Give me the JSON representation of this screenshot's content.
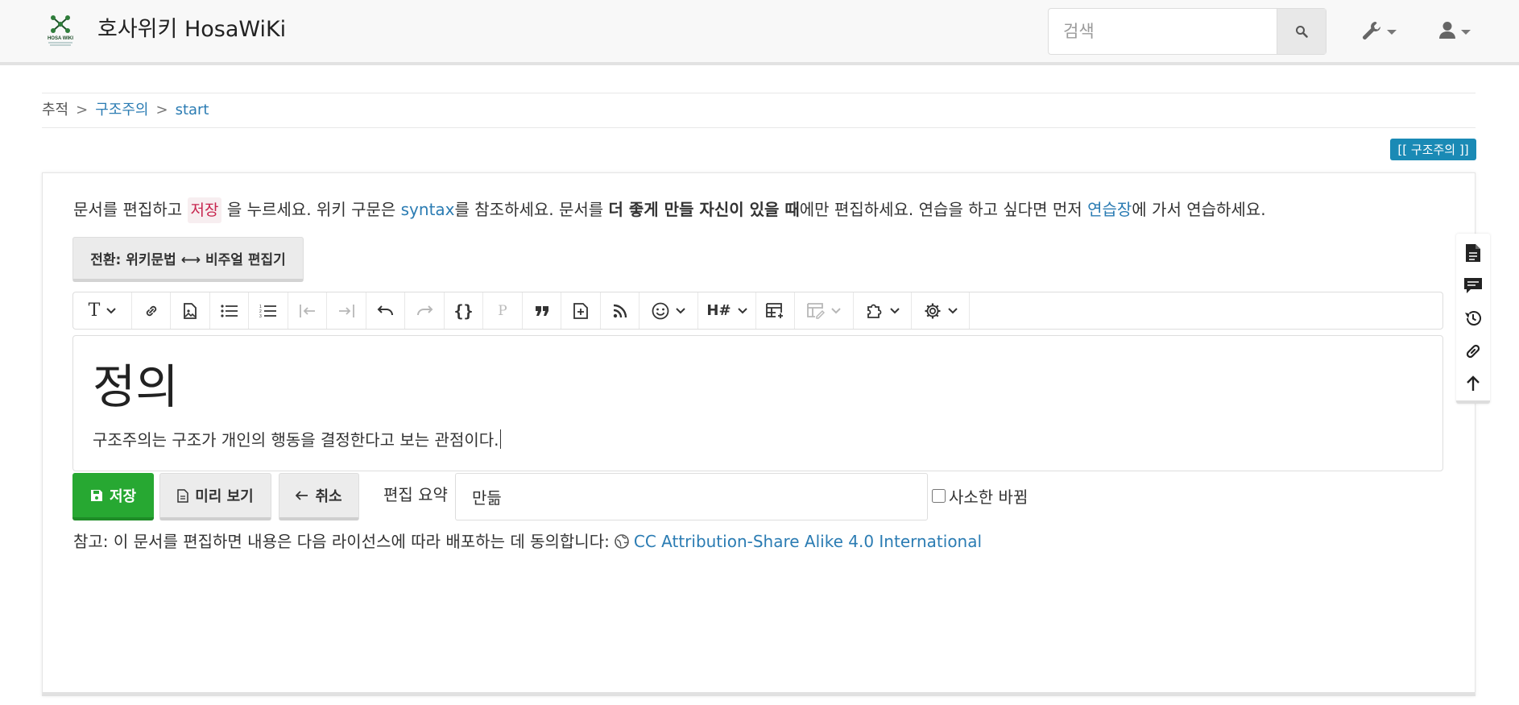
{
  "header": {
    "logo_text": "HOSA WIKI",
    "title": "호사위키 HosaWiKi",
    "search_placeholder": "검색"
  },
  "breadcrumbs": {
    "label": "추적",
    "items": [
      "구조주의",
      "start"
    ]
  },
  "page_tag": "[[ 구조주의 ]]",
  "intro": {
    "part1": "문서를 편집하고 ",
    "save_word": "저장",
    "part2": " 을 누르세요. 위키 구문은 ",
    "syntax_link": "syntax",
    "part3": "를 참조하세요. 문서를 ",
    "bold": "더 좋게 만들 자신이 있을 때",
    "part4": "에만 편집하세요. 연습을 하고 싶다면 먼저 ",
    "sandbox_link": "연습장",
    "part5": "에 가서 연습하세요."
  },
  "switch_button": "전환: 위키문법 ⟷ 비주얼 편집기",
  "toolbar": {
    "items": [
      "text-style",
      "link",
      "image",
      "bullet-list",
      "numbered-list",
      "outdent",
      "indent",
      "undo",
      "redo",
      "code",
      "paragraph",
      "blockquote",
      "insert-block",
      "rss",
      "emoji",
      "heading",
      "table",
      "table-edit",
      "plugins",
      "settings"
    ],
    "code_label": "{}",
    "paragraph_label": "P",
    "heading_label": "H#"
  },
  "editor": {
    "heading": "정의",
    "body": "구조주의는 구조가 개인의 행동을 결정한다고 보는 관점이다."
  },
  "actions": {
    "save": "저장",
    "preview": "미리 보기",
    "cancel": "취소",
    "summary_label": "편집 요약",
    "summary_value": "만듦",
    "minor_label": "사소한 바뀜"
  },
  "license": {
    "text": "참고: 이 문서를 편집하면 내용은 다음 라이선스에 따라 배포하는 데 동의합니다:",
    "link": "CC Attribution-Share Alike 4.0 International"
  },
  "side_tools": [
    "page-icon",
    "comments-icon",
    "history-icon",
    "backlinks-icon",
    "back-to-top-icon"
  ],
  "colors": {
    "accent": "#2b7cb3",
    "tag_bg": "#1a8ab5",
    "save_bg": "#27a832",
    "save_word": "#c7254e"
  }
}
